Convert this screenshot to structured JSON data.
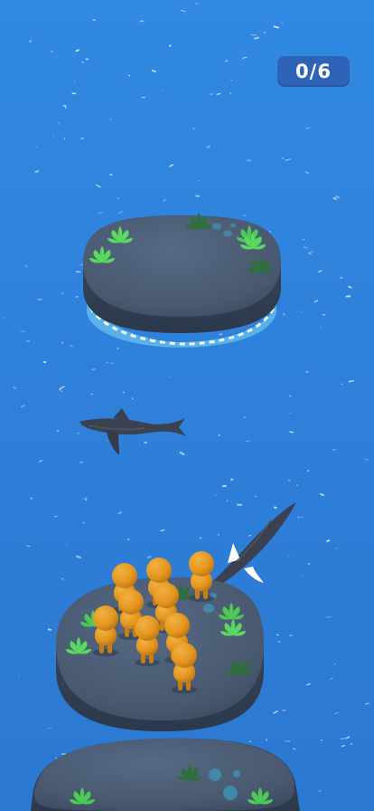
{
  "hud": {
    "progress_text": "0/6",
    "rescued": 0,
    "total": 6
  },
  "colors": {
    "water": "#2f82dc",
    "island": "#4a5b72",
    "character": "#e3961f",
    "shark": "#3b4150",
    "counter_bg": "#2f63b8"
  },
  "icons": [
    "counter-badge",
    "shark-icon",
    "plant-icon",
    "stick-figure-icon"
  ]
}
